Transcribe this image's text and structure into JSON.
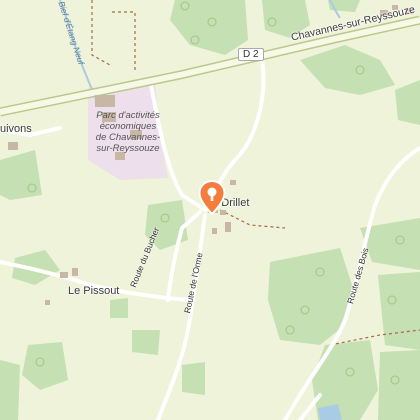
{
  "map": {
    "road_shield": "D 2",
    "places": {
      "village_east": "Chavannes-sur-Reyssouze",
      "village_west": "uivons",
      "hamlet_center": "Le Drillet",
      "hamlet_southwest": "Le Pissout"
    },
    "park": {
      "line1": "Parc d'activités",
      "line2": "économiques",
      "line3": "de Chavannes-",
      "line4": "sur-Reyssouze"
    },
    "roads": {
      "bucher": "Route du Bucher",
      "orme": "Route de l'Orme",
      "bois": "Route des Bois"
    },
    "stream": "Bief d'Étang Neuf",
    "colors": {
      "background": "#eef3d9",
      "forest": "#c5e0b3",
      "park_zone": "#ede0ec",
      "main_road_casing": "#b8c98a",
      "main_road": "#f7f9e6",
      "minor_road": "#ffffff",
      "water": "#a9cbe3",
      "marker": "#f47c3c"
    },
    "marker_icon": "map-pin-icon"
  }
}
